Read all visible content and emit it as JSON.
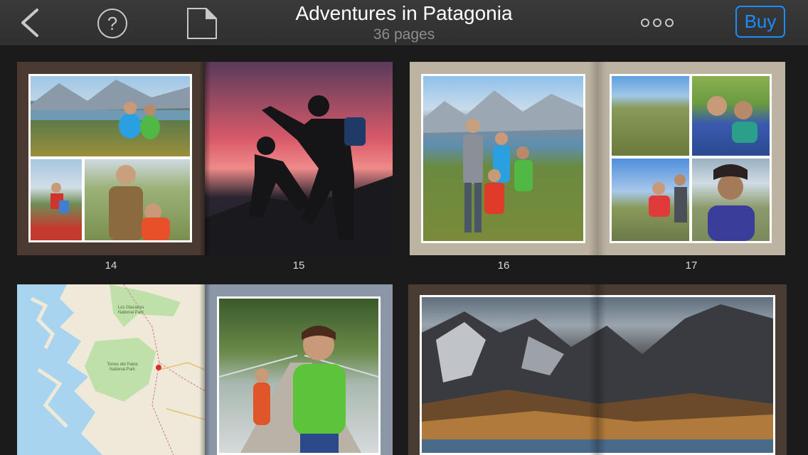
{
  "toolbar": {
    "title": "Adventures in Patagonia",
    "subtitle": "36 pages",
    "buy_label": "Buy",
    "icons": [
      "chevron-left-icon",
      "help-circle-icon",
      "page-icon",
      "more-dots-icon"
    ],
    "accent_color": "#1a8cff"
  },
  "pages": {
    "p14": "14",
    "p15": "15",
    "p16": "16",
    "p17": "17"
  },
  "map": {
    "label_glaciares": "Los Glaciares National Park",
    "label_torres": "Torres del Paine National Park"
  }
}
